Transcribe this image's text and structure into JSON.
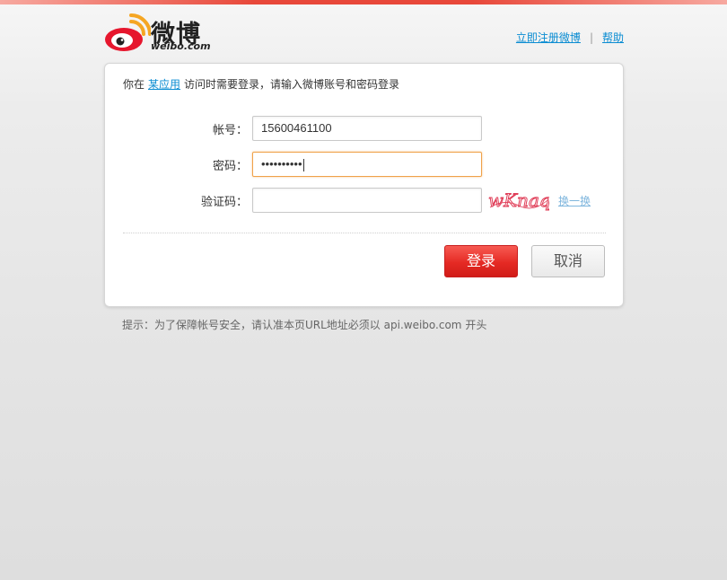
{
  "brand": {
    "logo_word": "微博",
    "logo_domain": "weibo.com",
    "brand_red": "#e8483a",
    "brand_orange": "#f5a623"
  },
  "header": {
    "links": [
      "立即注册微博",
      "帮助"
    ],
    "separator": "|"
  },
  "notice": {
    "prefix": "你在",
    "app_link": "某应用",
    "suffix": "访问时需要登录，请输入微博账号和密码登录"
  },
  "form": {
    "account_label": "帐号：",
    "account_value": "15600461100",
    "password_label": "密码：",
    "password_value": "••••••••••",
    "captcha_label": "验证码：",
    "captcha_value": "",
    "captcha_image_text": "wKnaq",
    "change_captcha": "换一换"
  },
  "buttons": {
    "login": "登录",
    "cancel": "取消"
  },
  "footnote": {
    "text": "提示：为了保障帐号安全，请认准本页URL地址必须以",
    "domain": "api.weibo.com",
    "tail": "开头"
  },
  "colors": {
    "link": "#0a8cd2",
    "focus_border": "#f0a24a",
    "login_button": "#e52a24"
  }
}
